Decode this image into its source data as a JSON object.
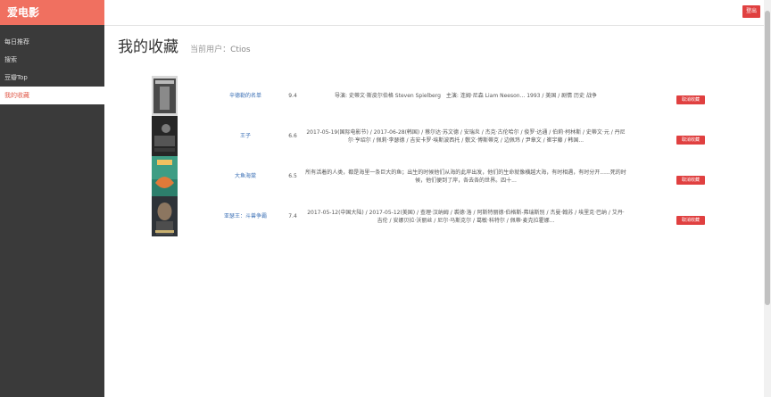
{
  "app": {
    "brand": "爱电影",
    "logout_label": "登出"
  },
  "sidebar": {
    "items": [
      {
        "label": "每日推荐",
        "active": false
      },
      {
        "label": "搜索",
        "active": false
      },
      {
        "label": "豆瓣Top",
        "active": false
      },
      {
        "label": "我的收藏",
        "active": true
      }
    ]
  },
  "main": {
    "title": "我的收藏",
    "current_user_label": "当前用户：",
    "current_user": "Ctios"
  },
  "movies": [
    {
      "title": "辛德勒的名单",
      "rating": "9.4",
      "info": "导演: 史蒂文·斯皮尔伯格 Steven Spielberg　主演: 连姆·尼森 Liam Neeson... 1993 / 美国 / 剧情 历史 战争",
      "remove_label": "取消收藏"
    },
    {
      "title": "王子",
      "rating": "6.6",
      "info": "2017-05-19(国际电影节) / 2017-06-28(韩国) / 蔡尔达·苏文德 / 安瑞炎 / 杰克·古伦哈尔 / 俊罗·达通 / 伯莉·柯林斯 / 史蒂文·元 / 丹尼尔·亨绍尔 / 佩莉·李瑟德 / 吉安卡罗·埃斯波西托 / 敷文·博斯蒂克 / 边佩玮 / 尹章文 / 崔宇藤 / 韩国...",
      "remove_label": "取消收藏"
    },
    {
      "title": "大鱼海棠",
      "rating": "6.5",
      "info": "所有活着的人类，都是海里一条巨大的鱼；出生的时候他们从海的此岸出发，他们的生命就像横越大海，有时相遇，有时分开......死的时候，他们便到了岸，各去各的世界。四十...",
      "remove_label": "取消收藏"
    },
    {
      "title": "亚瑟王：斗兽争霸",
      "rating": "7.4",
      "info": "2017-05-12(中国大陆) / 2017-05-12(美国) / 查理·汉纳姆 / 裘德·洛 / 阿斯特丽德·伯格斯-弗瑞斯别 / 杰曼·翰苏 / 埃里克·巴纳 / 艾丹·吉伦 / 安娜贝拉·沃丽丝 / 尼尔·马斯克尔 / 葛敏·科特尔 / 佩蒂·麦克拉霍娜...",
      "remove_label": "取消收藏"
    }
  ]
}
